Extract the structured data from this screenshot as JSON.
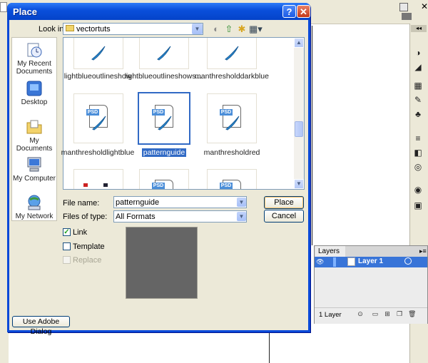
{
  "dialog": {
    "title": "Place",
    "help_label": "?",
    "close_label": "✕"
  },
  "look_in": {
    "label": "Look in:",
    "value": "vectortuts"
  },
  "places": [
    {
      "label": "My Recent Documents"
    },
    {
      "label": "Desktop"
    },
    {
      "label": "My Documents"
    },
    {
      "label": "My Computer"
    },
    {
      "label": "My Network"
    }
  ],
  "files": [
    {
      "name": "lightblueoutlineshow",
      "type": "PSD"
    },
    {
      "name": "lightblueoutlineshows...",
      "type": "PSD"
    },
    {
      "name": "manthresholddarkblue",
      "type": "PSD"
    },
    {
      "name": "manthresholdlightblue",
      "type": "PSD"
    },
    {
      "name": "patternguide",
      "type": "PSD",
      "selected": true
    },
    {
      "name": "manthresholdred",
      "type": "PSD"
    }
  ],
  "file_name": {
    "label": "File name:",
    "value": "patternguide"
  },
  "file_type": {
    "label": "Files of type:",
    "value": "All Formats"
  },
  "buttons": {
    "place": "Place",
    "cancel": "Cancel",
    "adobe_dialog": "Use Adobe Dialog"
  },
  "options": {
    "link": {
      "label": "Link",
      "checked": true
    },
    "template": {
      "label": "Template",
      "checked": false
    },
    "replace": {
      "label": "Replace",
      "checked": false,
      "disabled": true
    }
  },
  "layers_panel": {
    "tab": "Layers",
    "layer_name": "Layer 1",
    "count": "1 Layer"
  },
  "colors": {
    "xp_title_blue": "#0a50dc",
    "selection_blue": "#316ac5",
    "dialog_face": "#ece9d8",
    "layer_selected": "#3874d8",
    "preview_gray": "#656565"
  }
}
